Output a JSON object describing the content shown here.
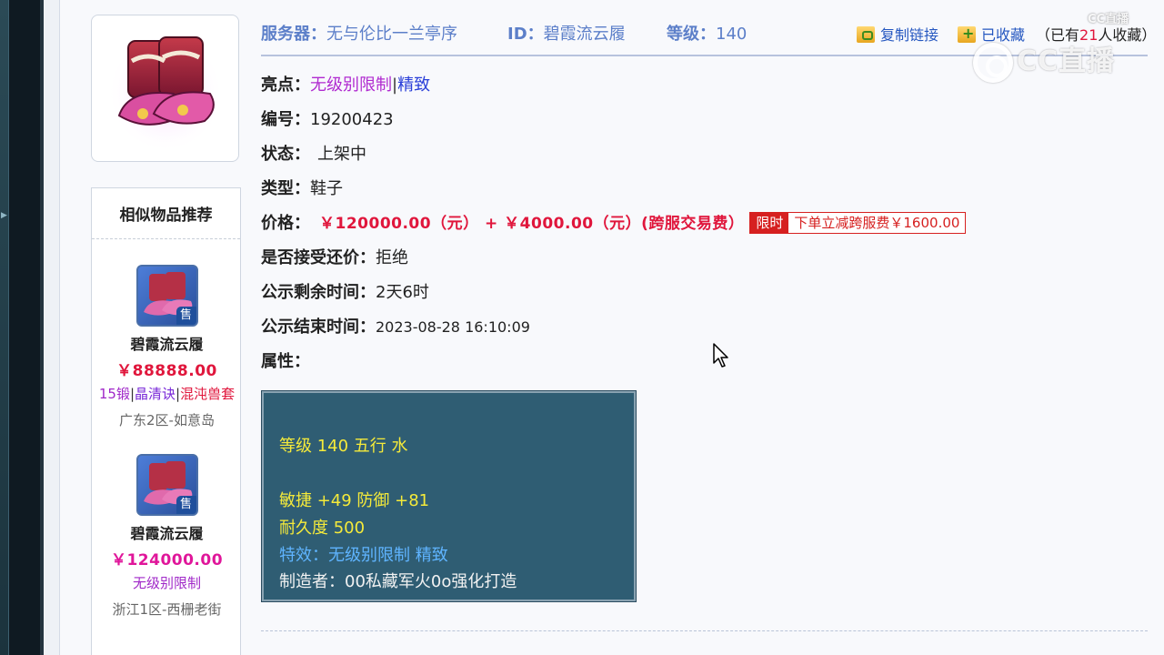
{
  "header": {
    "server_label": "服务器：",
    "server_value": "无与伦比一兰亭序",
    "id_label": "ID：",
    "id_value": "碧霞流云履",
    "level_label": "等级：",
    "level_value": "140",
    "copy_link": "复制链接",
    "favorited": "已收藏",
    "fav_prefix": "（已有",
    "fav_count": "21",
    "fav_suffix": "人收藏）"
  },
  "details": {
    "highlight_label": "亮点：",
    "highlight_1": "无级别限制",
    "highlight_sep": "|",
    "highlight_2": "精致",
    "number_label": "编号：",
    "number_value": "19200423",
    "status_label": "状态：",
    "status_value": "上架中",
    "type_label": "类型：",
    "type_value": "鞋子",
    "price_label": "价格：",
    "price_value": "￥120000.00（元） + ￥4000.00（元）(跨服交易费）",
    "limit_tag": "限时",
    "limit_text": "下单立减跨服费￥1600.00",
    "bargain_label": "是否接受还价：",
    "bargain_value": "拒绝",
    "remaining_label": "公示剩余时间：",
    "remaining_value": "2天6时",
    "end_label": "公示结束时间：",
    "end_value": "2023-08-28 16:10:09",
    "attr_label": "属性："
  },
  "attributes": {
    "line1": "等级 140 五行 水",
    "line2": "敏捷 +49 防御 +81",
    "line3": "耐久度 500",
    "line4": "特效：无级别限制 精致",
    "line5": "制造者：00私藏军火0o强化打造"
  },
  "similar": {
    "title": "相似物品推荐",
    "sale_badge": "售",
    "items": [
      {
        "name": "碧霞流云履",
        "price": "￥88888.00",
        "tag1": "15锻",
        "tag2": "晶清诀",
        "tag3": "混沌兽套",
        "sep": "|",
        "server": "广东2区-如意岛"
      },
      {
        "name": "碧霞流云履",
        "price": "￥124000.00",
        "tag1": "无级别限制",
        "server": "浙江1区-西栅老街"
      }
    ]
  },
  "watermark": {
    "brand_large": "CC直播",
    "brand_small": "CC直播"
  },
  "colors": {
    "link_blue": "#5c7fc9",
    "price_red": "#e0163c",
    "attr_bg": "#2f5d73",
    "attr_yellow": "#f5ea3a",
    "attr_blue": "#5fb4ff"
  }
}
